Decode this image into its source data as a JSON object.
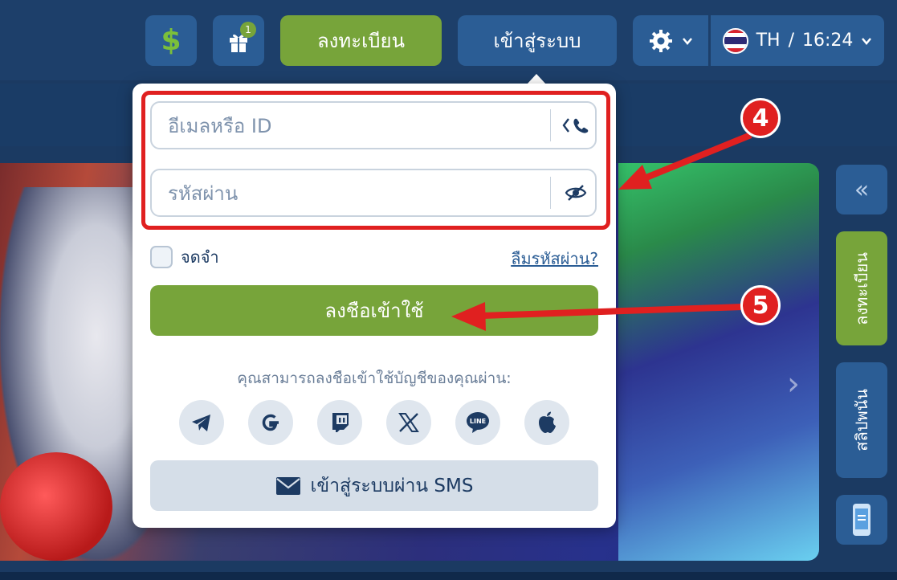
{
  "header": {
    "gift_badge": "1",
    "register_label": "ลงทะเบียน",
    "login_label": "เข้าสู่ระบบ",
    "lang_code": "TH",
    "separator": "/",
    "time": "16:24"
  },
  "login_popup": {
    "email_placeholder": "อีเมลหรือ ID",
    "password_placeholder": "รหัสผ่าน",
    "remember_label": "จดจำ",
    "forgot_label": "ลืมรหัสผ่าน?",
    "submit_label": "ลงชือเข้าใช้",
    "social_prompt": "คุณสามารถลงชือเข้าใช้บัญชีของคุณผ่าน:",
    "sms_label": "เข้าสู่ระบบผ่าน SMS"
  },
  "sidebar": {
    "collapse_icon": "«",
    "register_label": "ลงทะเบียน",
    "slip_label": "สลิปพนัน"
  },
  "annotations": {
    "step4": "4",
    "step5": "5"
  },
  "colors": {
    "accent_green": "#77a43a",
    "navy": "#1d3f6a",
    "highlight_red": "#e02020"
  },
  "icons": [
    "dollar-icon",
    "gift-icon",
    "gear-icon",
    "flag-th-icon",
    "phone-icon",
    "eye-off-icon",
    "telegram-icon",
    "google-icon",
    "twitch-icon",
    "x-icon",
    "line-icon",
    "apple-icon",
    "envelope-icon",
    "mobile-app-icon"
  ]
}
